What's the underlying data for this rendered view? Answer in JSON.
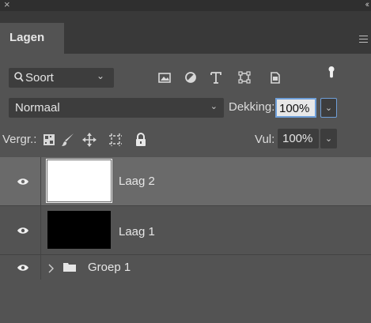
{
  "window": {
    "close_glyph": "×",
    "collapse_glyph": "‹‹"
  },
  "tabs": [
    {
      "label": "Lagen",
      "active": true
    }
  ],
  "filter": {
    "kind_label": "Soort",
    "chevron": "⌄",
    "icons": [
      "image-filter-icon",
      "adjustment-filter-icon",
      "type-filter-icon",
      "shape-filter-icon",
      "smart-object-filter-icon",
      "filter-toggle-icon"
    ]
  },
  "blend": {
    "mode": "Normaal",
    "opacity_label": "Dekking:",
    "opacity_value": "100%"
  },
  "lock": {
    "label": "Vergr.:",
    "fill_label": "Vul:",
    "fill_value": "100%",
    "icons": [
      "lock-transparent-pixels-icon",
      "lock-image-pixels-icon",
      "lock-position-icon",
      "lock-artboard-icon",
      "lock-all-icon"
    ]
  },
  "layers": [
    {
      "name": "Laag 2",
      "type": "layer",
      "thumbnail": "#ffffff",
      "selected": true,
      "visible": true
    },
    {
      "name": "Laag 1",
      "type": "layer",
      "thumbnail": "#000000",
      "selected": false,
      "visible": true
    },
    {
      "name": "Groep 1",
      "type": "group",
      "selected": false,
      "visible": true
    }
  ],
  "colors": {
    "panel": "#535353",
    "selected_row": "#6a6a6a",
    "field": "#3d3d3d",
    "focus": "#6f9fd8"
  }
}
